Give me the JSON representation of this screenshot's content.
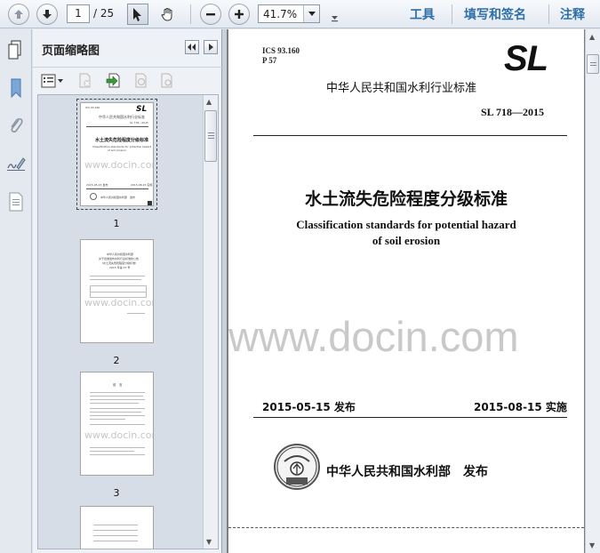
{
  "toolbar": {
    "current_page": "1",
    "total_pages": "/ 25",
    "zoom": "41.7%",
    "menu_tools": "工具",
    "menu_fill_sign": "填写和签名",
    "menu_comment": "注释",
    "accent": "#2f6fa8"
  },
  "pane": {
    "title": "页面缩略图"
  },
  "thumbnails": [
    {
      "page": "1"
    },
    {
      "page": "2"
    },
    {
      "page": "3"
    }
  ],
  "thumb1": {
    "ics": "ICS 93.160",
    "org": "中华人民共和国水利行业标准",
    "code": "SL 718—2015",
    "title": "水土流失危险程度分级标准",
    "en1": "Classification standards for potential hazard",
    "en2": "of soil erosion",
    "issue": "2015-05-15 发布",
    "impl": "2015-08-15 实施",
    "publisher": "中华人民共和国水利部　发布"
  },
  "thumb2": {
    "h1": "中华人民共和国水利部",
    "h2": "关于批准发布水利行业标准的公告",
    "h3": "（水土流失危险程度分级标准）",
    "h4": "2015 年第 25 号"
  },
  "thumb3": {
    "h1": "前　言"
  },
  "document": {
    "ics": "ICS 93.160",
    "p": "P 57",
    "logo": "SL",
    "org": "中华人民共和国水利行业标准",
    "code": "SL 718—2015",
    "title_cn": "水土流失危险程度分级标准",
    "title_en_1": "Classification standards for potential hazard",
    "title_en_2": "of soil erosion",
    "issue_date": "2015-05-15 发布",
    "impl_date": "2015-08-15 实施",
    "publisher": "中华人民共和国水利部　发布"
  },
  "watermark": "www.docin.com",
  "thumb_watermark": "www.docin.com"
}
